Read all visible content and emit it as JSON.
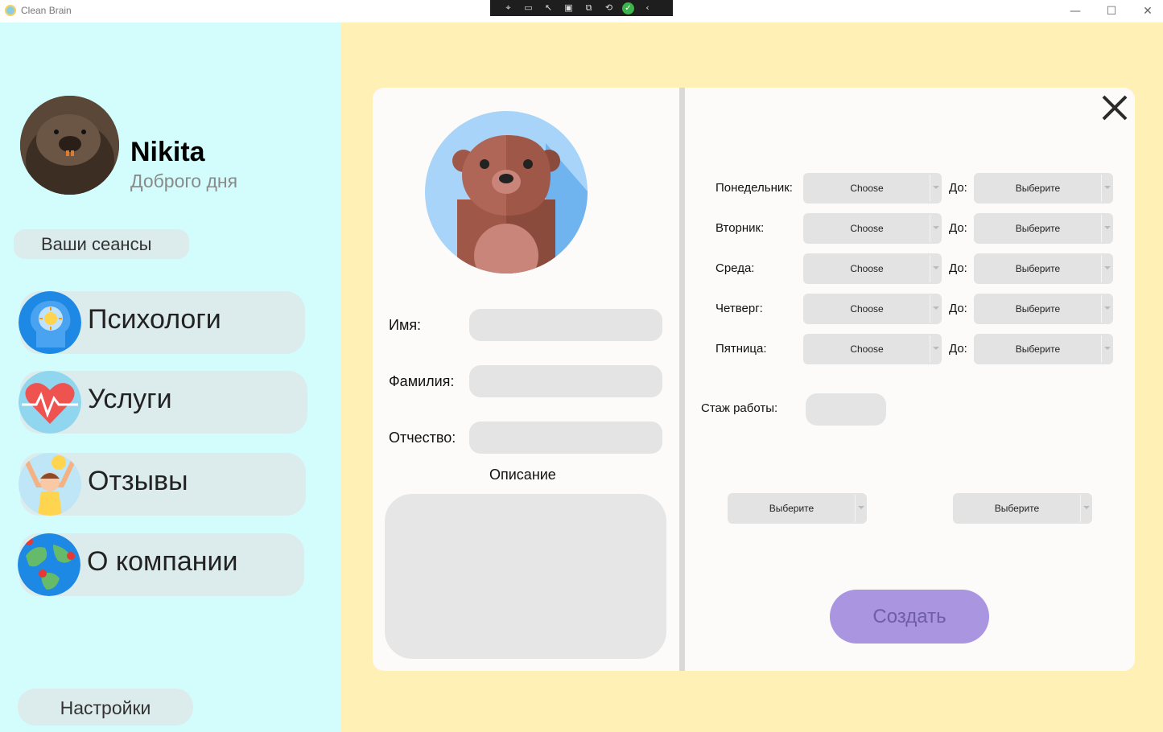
{
  "window": {
    "title": "Clean Brain",
    "controls": {
      "minimize": "—",
      "maximize": "☐",
      "close": "✕"
    }
  },
  "debug_toolbar": {
    "icons": [
      "select-element-icon",
      "record-icon",
      "pointer-icon",
      "frame-icon",
      "layout-icon",
      "hot-reload-icon",
      "status-ok-icon",
      "collapse-icon"
    ]
  },
  "sidebar": {
    "user": {
      "name": "Nikita",
      "greeting": "Доброго дня"
    },
    "sessions_button": "Ваши сеансы",
    "nav": [
      {
        "label": "Психологи",
        "icon": "head-gear-icon"
      },
      {
        "label": "Услуги",
        "icon": "heartbeat-icon"
      },
      {
        "label": "Отзывы",
        "icon": "happy-person-icon"
      },
      {
        "label": "О компании",
        "icon": "globe-pins-icon"
      }
    ],
    "settings_button": "Настройки"
  },
  "form": {
    "avatar_icon": "bear-avatar-icon",
    "first_name_label": "Имя:",
    "last_name_label": "Фамилия:",
    "patronymic_label": "Отчество:",
    "first_name_value": "",
    "last_name_value": "",
    "patronymic_value": "",
    "description_title": "Описание",
    "description_value": "",
    "schedule": [
      {
        "day": "Понедельник:",
        "from": "Choose",
        "to_label": "До:",
        "to": "Выберите"
      },
      {
        "day": "Вторник:",
        "from": "Choose",
        "to_label": "До:",
        "to": "Выберите"
      },
      {
        "day": "Среда:",
        "from": "Choose",
        "to_label": "До:",
        "to": "Выберите"
      },
      {
        "day": "Четверг:",
        "from": "Choose",
        "to_label": "До:",
        "to": "Выберите"
      },
      {
        "day": "Пятница:",
        "from": "Choose",
        "to_label": "До:",
        "to": "Выберите"
      }
    ],
    "experience_label": "Стаж работы:",
    "experience_value": "",
    "extra_select_1": "Выберите",
    "extra_select_2": "Выберите",
    "create_button": "Создать"
  },
  "colors": {
    "sidebar_bg": "#d2fdfc",
    "main_bg": "#fff0b5",
    "card_bg": "#fcfbf9",
    "input_bg": "#e4e4e4",
    "create_button_bg": "#a995e0"
  }
}
